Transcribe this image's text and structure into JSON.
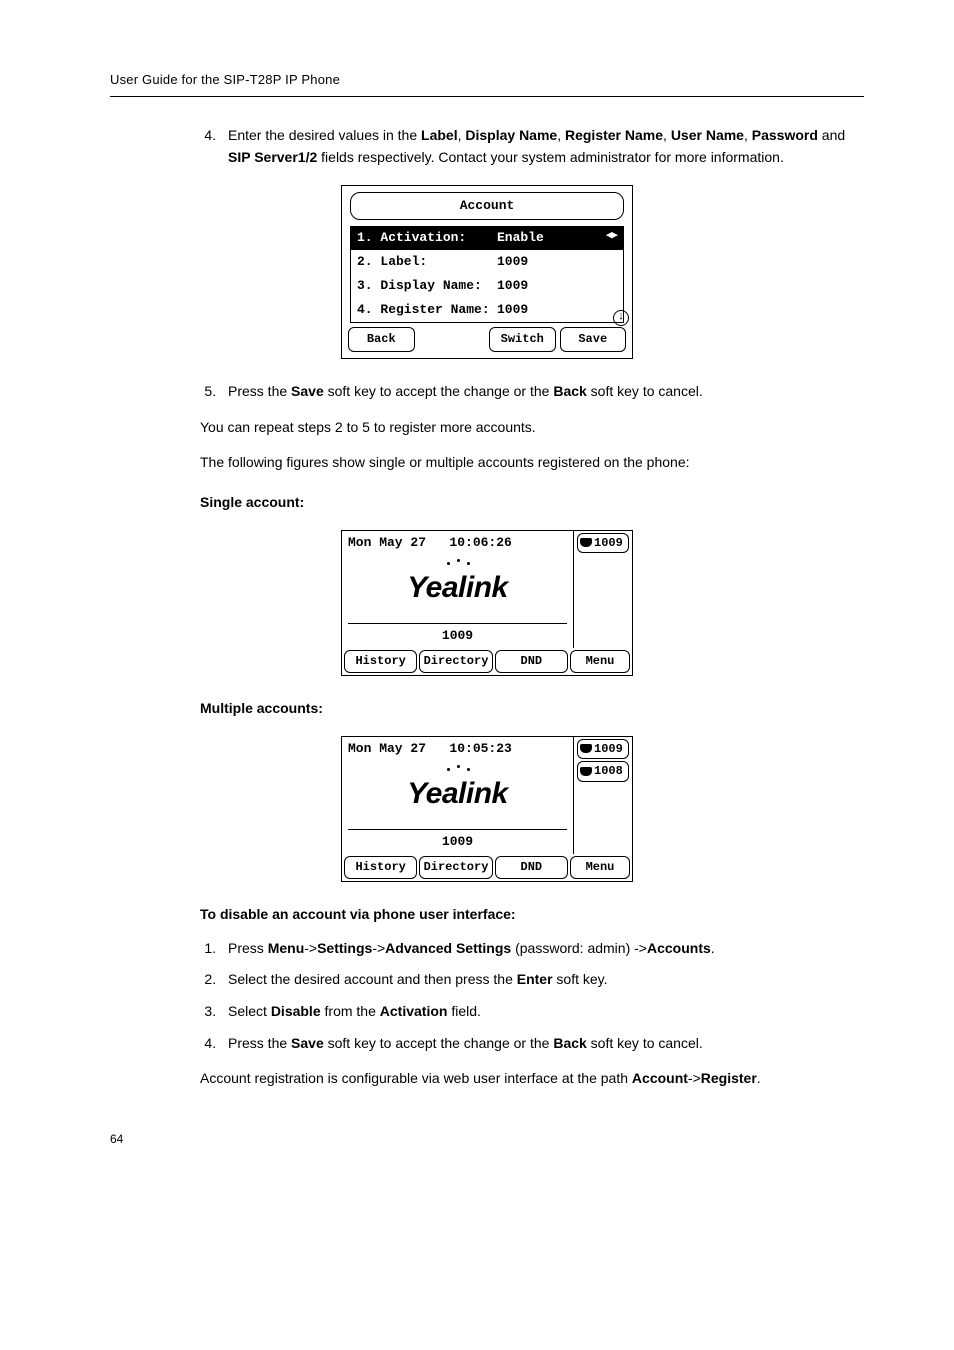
{
  "header": {
    "title": "User Guide for the SIP-T28P IP Phone"
  },
  "step4": {
    "num": "4.",
    "text_a": "Enter the desired values in the ",
    "b1": "Label",
    "c1": ", ",
    "b2": "Display Name",
    "c2": ", ",
    "b3": "Register Name",
    "c3": ", ",
    "b4": "User Name",
    "c4": ", ",
    "b5": "Password",
    "text_b": " and ",
    "b6": "SIP Server1/2",
    "text_c": " fields respectively. Contact your system administrator for more information."
  },
  "fig_account": {
    "title": "Account",
    "rows": [
      {
        "label": "1. Activation:",
        "value": "Enable",
        "arrows": "◀▶",
        "selected": true
      },
      {
        "label": "2. Label:",
        "value": "1009",
        "arrows": "",
        "selected": false
      },
      {
        "label": "3. Display Name:",
        "value": "1009",
        "arrows": "",
        "selected": false
      },
      {
        "label": "4. Register Name:",
        "value": "1009",
        "arrows": "",
        "selected": false
      }
    ],
    "scroll": "↓",
    "soft": [
      "Back",
      "",
      "Switch",
      "Save"
    ]
  },
  "step5": {
    "num": "5.",
    "text_a": "Press the ",
    "b1": "Save",
    "text_b": " soft key to accept the change or the ",
    "b2": "Back",
    "text_c": " soft key to cancel."
  },
  "para_repeat": "You can repeat steps 2 to 5 to register more accounts.",
  "para_figures": "The following figures show single or multiple accounts registered on the phone:",
  "single_head": "Single account:",
  "fig_single": {
    "date": "Mon May 27",
    "time": "10:06:26",
    "side": [
      "1009"
    ],
    "bottom": "1009",
    "soft": [
      "History",
      "Directory",
      "DND",
      "Menu"
    ]
  },
  "multi_head": "Multiple accounts:",
  "fig_multi": {
    "date": "Mon May 27",
    "time": "10:05:23",
    "side": [
      "1009",
      "1008"
    ],
    "bottom": "1009",
    "soft": [
      "History",
      "Directory",
      "DND",
      "Menu"
    ]
  },
  "disable_head": "To disable an account via phone user interface:",
  "dsteps": [
    {
      "num": "1.",
      "parts": [
        {
          "t": "Press "
        },
        {
          "b": "Menu"
        },
        {
          "t": "->"
        },
        {
          "b": "Settings"
        },
        {
          "t": "->"
        },
        {
          "b": "Advanced Settings"
        },
        {
          "t": " (password: admin) ->"
        },
        {
          "b": "Accounts"
        },
        {
          "t": "."
        }
      ]
    },
    {
      "num": "2.",
      "parts": [
        {
          "t": "Select the desired account and then press the "
        },
        {
          "b": "Enter"
        },
        {
          "t": " soft key."
        }
      ]
    },
    {
      "num": "3.",
      "parts": [
        {
          "t": "Select "
        },
        {
          "b": "Disable"
        },
        {
          "t": " from the "
        },
        {
          "b": "Activation"
        },
        {
          "t": " field."
        }
      ]
    },
    {
      "num": "4.",
      "parts": [
        {
          "t": "Press the "
        },
        {
          "b": "Save"
        },
        {
          "t": " soft key to accept the change or the "
        },
        {
          "b": "Back"
        },
        {
          "t": " soft key to cancel."
        }
      ]
    }
  ],
  "closing": {
    "text_a": "Account registration is configurable via web user interface at the path ",
    "b1": "Account",
    "mid": "->",
    "b2": "Register",
    "tail": "."
  },
  "page_num": "64"
}
